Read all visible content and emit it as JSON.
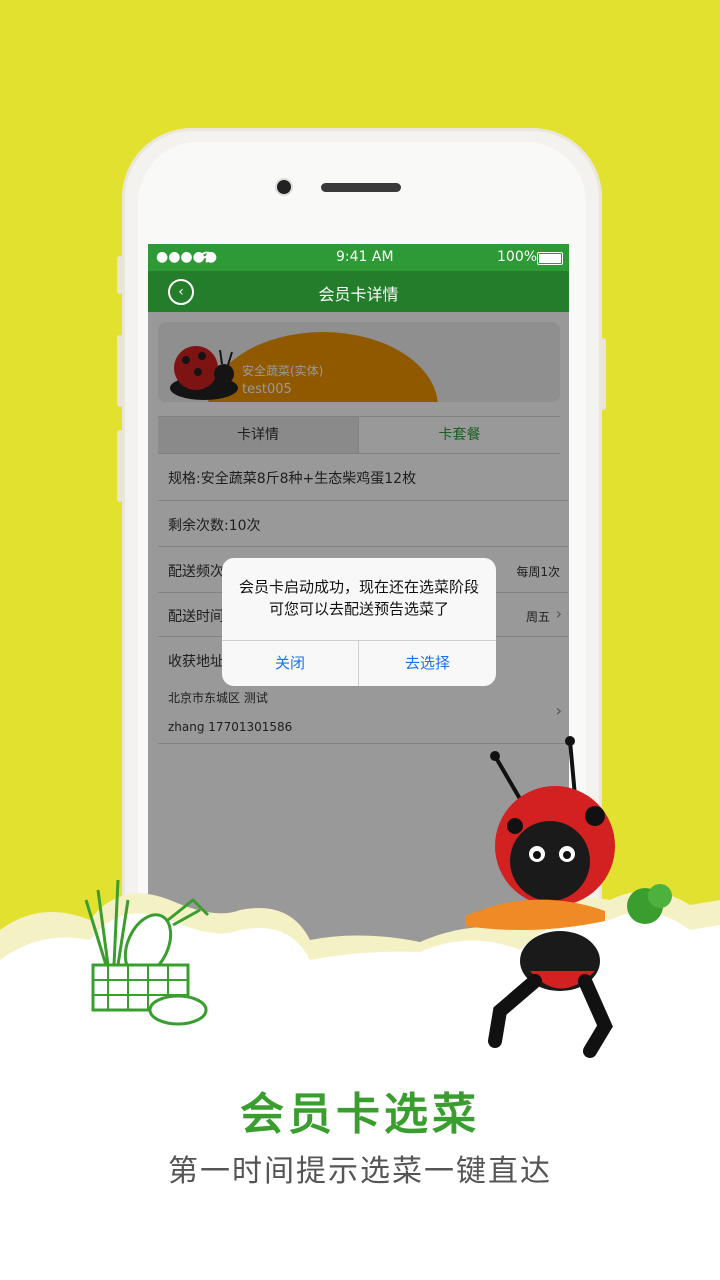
{
  "status_bar": {
    "carrier": "●●●●● ",
    "time": "9:41 AM",
    "battery": "100%"
  },
  "nav": {
    "title": "会员卡详情",
    "back_icon": "‹"
  },
  "card": {
    "type": "安全蔬菜(实体)",
    "id": "test005"
  },
  "tabs": [
    {
      "label": "卡详情"
    },
    {
      "label": "卡套餐"
    }
  ],
  "rows": {
    "spec": "规格:安全蔬菜8斤8种+生态柴鸡蛋12枚",
    "remaining": "剩余次数:10次",
    "frequency_label": "配送频次",
    "frequency_value": "每周1次",
    "time_label": "配送时间",
    "time_value": "周五",
    "address_label": "收获地址",
    "address_line": "北京市东城区 测试",
    "contact_line": "zhang 17701301586"
  },
  "dialog": {
    "message": "会员卡启动成功，现在还在选菜阶段可您可以去配送预告选菜了",
    "close": "关闭",
    "choose": "去选择"
  },
  "promo": {
    "headline": "会员卡选菜",
    "subline": "第一时间提示选菜一键直达"
  },
  "colors": {
    "background": "#e2e130",
    "green": "#2e9a36",
    "card_orange": "#f19400",
    "link_blue": "#1a73e8"
  }
}
